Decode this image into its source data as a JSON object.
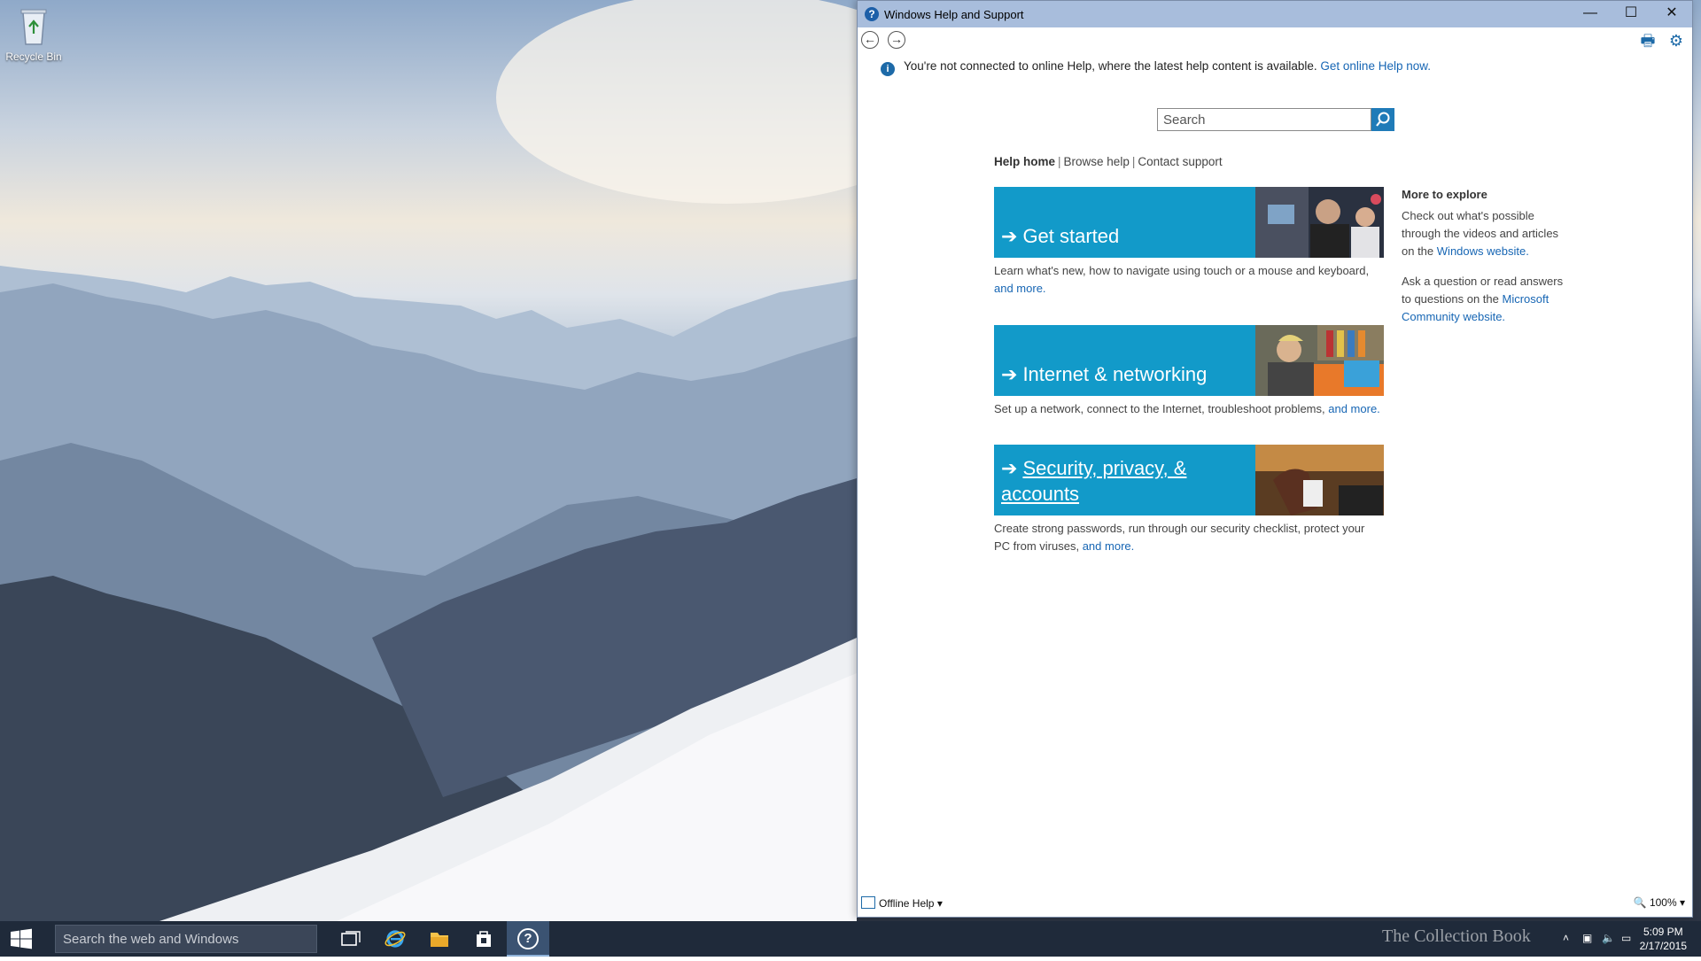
{
  "desktop": {
    "recycle_bin_label": "Recycle Bin"
  },
  "window": {
    "title": "Windows Help and Support",
    "minimize_glyph": "—",
    "maximize_glyph": "☐",
    "close_glyph": "✕"
  },
  "toolbar": {
    "back_glyph": "←",
    "forward_glyph": "→",
    "print_glyph": "🖶",
    "settings_glyph": "⚙"
  },
  "info_bar": {
    "message": "You're not connected to online Help, where the latest help content is available.",
    "link": "Get online Help now."
  },
  "search": {
    "placeholder": "Search"
  },
  "help_nav": {
    "home": "Help home",
    "sep": "|",
    "browse": "Browse help",
    "contact": "Contact support"
  },
  "tiles": [
    {
      "label": "Get started",
      "desc": "Learn what's new, how to navigate using touch or a mouse and keyboard,",
      "link": "and more."
    },
    {
      "label": "Internet & networking",
      "desc": "Set up a network, connect to the Internet, troubleshoot problems,",
      "link": "and more."
    },
    {
      "label": "Security, privacy, & accounts",
      "desc": "Create strong passwords, run through our security checklist, protect your PC from viruses,",
      "link": "and more."
    }
  ],
  "arrow_glyph": "➔",
  "explore": {
    "heading": "More to explore",
    "p1_text": "Check out what's possible through the videos and articles on the",
    "p1_link": "Windows website.",
    "p2_text": "Ask a question or read answers to questions on the",
    "p2_link": "Microsoft Community website."
  },
  "statusbar": {
    "offline_label": "Offline Help",
    "zoom_label": "100%"
  },
  "taskbar": {
    "search_placeholder": "Search the web and Windows",
    "help_glyph": "?",
    "watermark": "The Collection Book",
    "time": "5:09 PM",
    "date": "2/17/2015"
  },
  "colors": {
    "accent": "#129ac9",
    "link": "#1766b4",
    "titlebar": "#a8bddc",
    "taskbar": "#1f2a3a"
  }
}
